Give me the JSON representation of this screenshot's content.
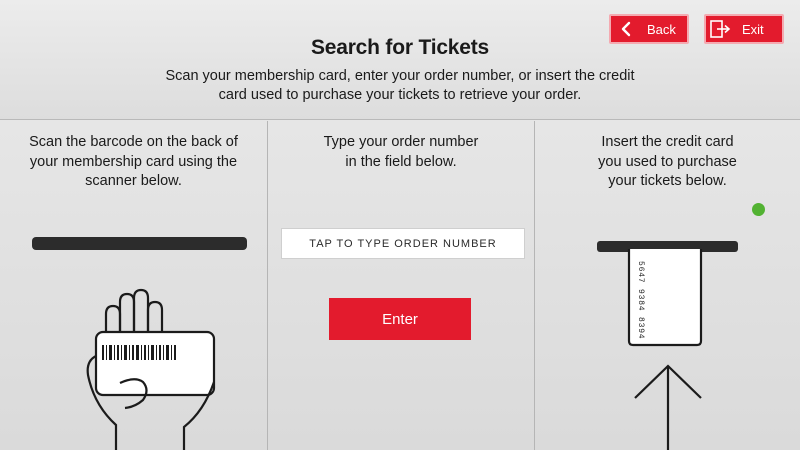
{
  "header": {
    "title": "Search for Tickets",
    "subtitle": "Scan your membership card, enter your order number, or insert the credit card used to purchase your tickets to retrieve your order.",
    "back_label": "Back",
    "exit_label": "Exit"
  },
  "panels": {
    "scan": {
      "instructions": "Scan the barcode on the back of your membership card using the scanner below."
    },
    "order": {
      "instructions": "Type your order number in the field below.",
      "input_placeholder": "TAP TO TYPE ORDER NUMBER",
      "input_value": "",
      "enter_label": "Enter"
    },
    "card": {
      "instructions": "Insert the credit card you used to purchase your tickets below.",
      "card_number": "5647 9384 8394"
    }
  },
  "icons": {
    "back": "chevron-left-icon",
    "exit": "exit-door-icon",
    "status": "status-dot-icon",
    "scan_illustration": "hand-holding-card-icon",
    "card_illustration": "credit-card-icon",
    "arrow": "arrow-up-icon"
  },
  "colors": {
    "accent": "#e31b2d",
    "status": "#52b232",
    "background": "#e4e4e4"
  }
}
